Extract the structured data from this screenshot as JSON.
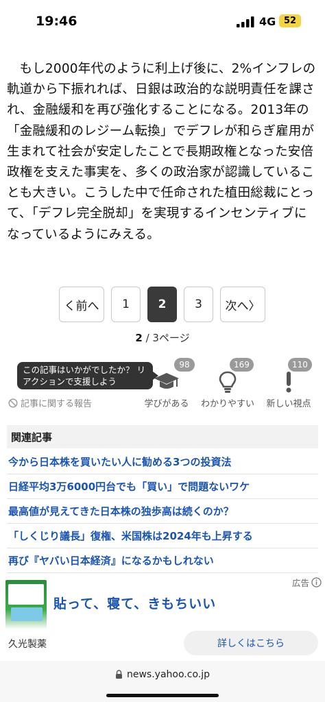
{
  "status_bar": {
    "time": "19:46",
    "network": "4G",
    "battery": "52",
    "battery_color": "#f5d442"
  },
  "article": {
    "paragraph": "もし2000年代のように利上げ後に、2%インフレの軌道から下振れれば、日銀は政治的な説明責任を課され、金融緩和を再び強化することになる。2013年の「金融緩和のレジーム転換」でデフレが和らぎ雇用が生まれて社会が安定したことで長期政権となった安倍政権を支えた事実を、多くの政治家が認識していることも大きい。こうした中で任命された植田総裁にとって、「デフレ完全脱却」を実現するインセンティブになっているようにみえる。"
  },
  "pagination": {
    "prev_label": "く前へ",
    "pages": [
      "1",
      "2",
      "3"
    ],
    "current": "2",
    "next_label": "次へ〉",
    "current_page": "2",
    "page_info_suffix": " / 3ページ"
  },
  "reactions": {
    "tooltip": "この記事はいかがでしたか？ リアクションで支援しよう",
    "report_label": "記事に関する報告",
    "items": [
      {
        "count": "98",
        "label": "学びがある",
        "icon": "graduation-cap-icon"
      },
      {
        "count": "169",
        "label": "わかりやすい",
        "icon": "lightbulb-icon"
      },
      {
        "count": "110",
        "label": "新しい視点",
        "icon": "exclamation-icon"
      }
    ]
  },
  "related": {
    "heading": "関連記事",
    "items": [
      "今から日本株を買いたい人に勧める3つの投資法",
      "日経平均3万6000円台でも「買い」で問題ないワケ",
      "最高値が見えてきた日本株の独歩高は続くのか？",
      "「しくじり議長」復権、米国株は2024年も上昇する",
      "再び『ヤバい日本経済』になるかもしれない"
    ]
  },
  "ad": {
    "label": "広告",
    "headline": "貼って、寝て、きもちいい",
    "advertiser": "久光製薬",
    "cta": "詳しくはこちら"
  },
  "browser": {
    "url": "news.yahoo.co.jp"
  },
  "colors": {
    "link": "#1a55b3",
    "active_page": "#3a3a3a"
  }
}
